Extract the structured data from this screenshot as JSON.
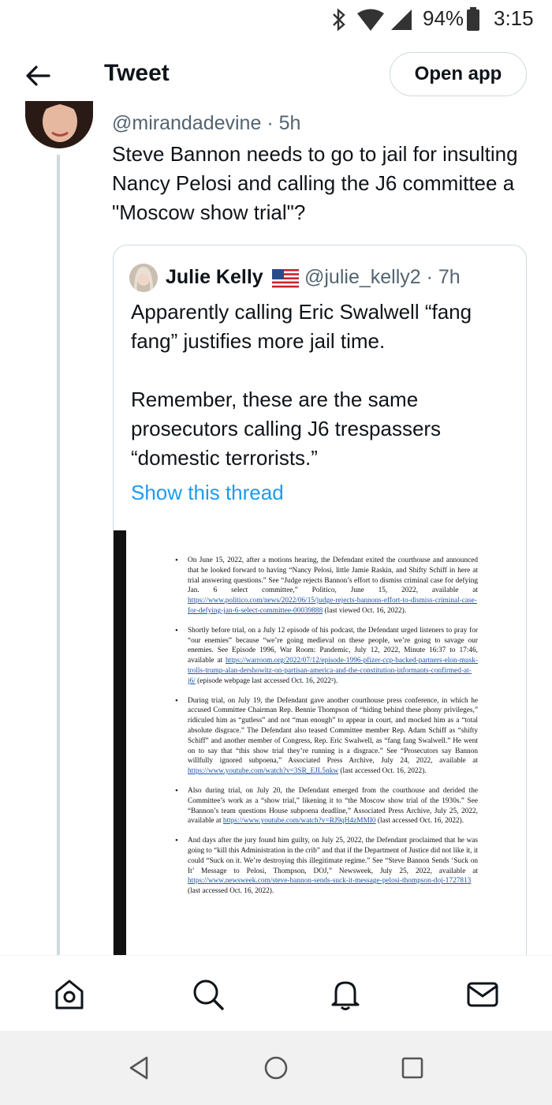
{
  "status_bar": {
    "battery": "94%",
    "time": "3:15",
    "icons": [
      "bluetooth-icon",
      "wifi-icon",
      "cell-signal-icon",
      "battery-icon"
    ]
  },
  "header": {
    "title": "Tweet",
    "open_app_label": "Open app",
    "back_icon": "back-arrow-icon"
  },
  "tweet": {
    "handle": "@mirandadevine",
    "time": "5h",
    "text": "Steve Bannon needs to go to jail for insulting Nancy Pelosi and calling the J6 committee a \"Moscow show trial\"?"
  },
  "quote": {
    "name": "Julie Kelly",
    "flag": "us-flag-icon",
    "handle": "@julie_kelly2",
    "time": "7h",
    "text": "Apparently calling Eric Swalwell “fang fang” justifies more jail time.\n\nRemember, these are the same prosecutors calling J6 trespassers “domestic terrorists.”",
    "show_thread": "Show this thread"
  },
  "document": {
    "items": [
      {
        "text": "On June 15, 2022, after a motions hearing, the Defendant exited the courthouse and announced that he looked forward to having “Nancy Pelosi, little Jamie Raskin, and Shifty Schiff in here at trial answering questions.” See “Judge rejects Bannon’s effort to dismiss criminal case for defying Jan. 6 select committee,” Politico, June 15, 2022, available at ",
        "link": "https://www.politico.com/news/2022/06/15/judge-rejects-bannons-effort-to-dismiss-criminal-case-for-defying-jan-6-select-committee-00039888",
        "after": " (last viewed Oct. 16, 2022)."
      },
      {
        "text": "Shortly before trial, on a July 12 episode of his podcast, the Defendant urged listeners to pray for “our enemies” because “we’re going medieval on these people, we’re going to savage our enemies. See Episode 1996, War Room: Pandemic, July 12, 2022, Minute 16:37 to 17:46, available at ",
        "link": "https://warroom.org/2022/07/12/episode-1996-pfizer-ccp-backed-partners-elon-musk-trolls-trump-alan-dershowitz-on-partisan-america-and-the-constitution-informants-confirmed-at-j6/",
        "after": " (episode webpage last accessed Oct. 16, 2022²)."
      },
      {
        "text": "During trial, on July 19, the Defendant gave another courthouse press conference, in which he accused Committee Chairman Rep. Bennie Thompson of “hiding behind these phony privileges,” ridiculed him as “gutless” and not “man enough” to appear in court, and mocked him as a “total absolute disgrace.” The Defendant also teased Committee member Rep. Adam Schiff as “shifty Schiff” and another member of Congress, Rep. Eric Swalwell, as “fang fang Swalwell.” He went on to say that “this show trial they’re running is a disgrace.” See “Prosecutors say Bannon willfully ignored subpoena,” Associated Press Archive, July 24, 2022, available at ",
        "link": "https://www.youtube.com/watch?v=3SR_EJL5nkw",
        "after": " (last accessed Oct. 16, 2022)."
      },
      {
        "text": "Also during trial, on July 20, the Defendant emerged from the courthouse and derided the Committee’s work as a “show trial,” likening it to “the Moscow show trial of the 1930s.” See “Bannon’s team questions House subpoena deadline,” Associated Press Archive, July 25, 2022, available at ",
        "link": "https://www.youtube.com/watch?v=RJ9qH4zMMI0",
        "after": " (last accessed Oct. 16, 2022)."
      },
      {
        "text": "And days after the jury found him guilty, on July 25, 2022, the Defendant proclaimed that he was going to “kill this Administration in the crib” and that if the Department of Justice did not like it, it could “Suck on it. We’re destroying this illegitimate regime.” See “Steve Bannon Sends ‘Suck on It’ Message to Pelosi, Thompson, DOJ,” Newsweek, July 25, 2022, available at ",
        "link": "https://www.newsweek.com/steve-bannon-sends-suck-it-message-pelosi-thompson-doj-1727813",
        "after": " (last accessed Oct. 16, 2022)."
      }
    ]
  },
  "bottom_nav": [
    "home-icon",
    "search-icon",
    "notifications-icon",
    "messages-icon"
  ],
  "system_nav": [
    "back-triangle-icon",
    "home-circle-icon",
    "recents-square-icon"
  ]
}
